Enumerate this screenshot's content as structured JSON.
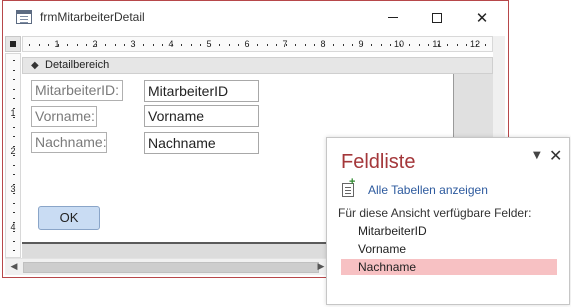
{
  "window": {
    "title": "frmMitarbeiterDetail",
    "minimize_icon": "minimize-icon",
    "maximize_icon": "maximize-icon",
    "close_glyph": "✕"
  },
  "ruler": {
    "horizontal_numbers": [
      "1",
      "2",
      "3",
      "4",
      "5",
      "6",
      "7",
      "8",
      "9",
      "10",
      "11",
      "12"
    ],
    "vertical_numbers": [
      "1",
      "2",
      "3",
      "4"
    ]
  },
  "section": {
    "arrow_glyph": "◆",
    "label": "Detailbereich"
  },
  "form": {
    "fields": [
      {
        "label": "MitarbeiterID:",
        "control": "MitarbeiterID"
      },
      {
        "label": "Vorname:",
        "control": "Vorname"
      },
      {
        "label": "Nachname:",
        "control": "Nachname"
      }
    ],
    "ok_label": "OK"
  },
  "scrollbar": {
    "left_arrow": "◀",
    "right_arrow": "▶"
  },
  "field_list": {
    "title": "Feldliste",
    "menu_glyph": "▼",
    "close_glyph": "✕",
    "show_all_tables": "Alle Tabellen anzeigen",
    "available_label": "Für diese Ansicht verfügbare Felder:",
    "fields": [
      "MitarbeiterID",
      "Vorname",
      "Nachname"
    ],
    "selected": "Nachname",
    "selection_color": "#f7c1c3",
    "title_color": "#a4373a"
  }
}
